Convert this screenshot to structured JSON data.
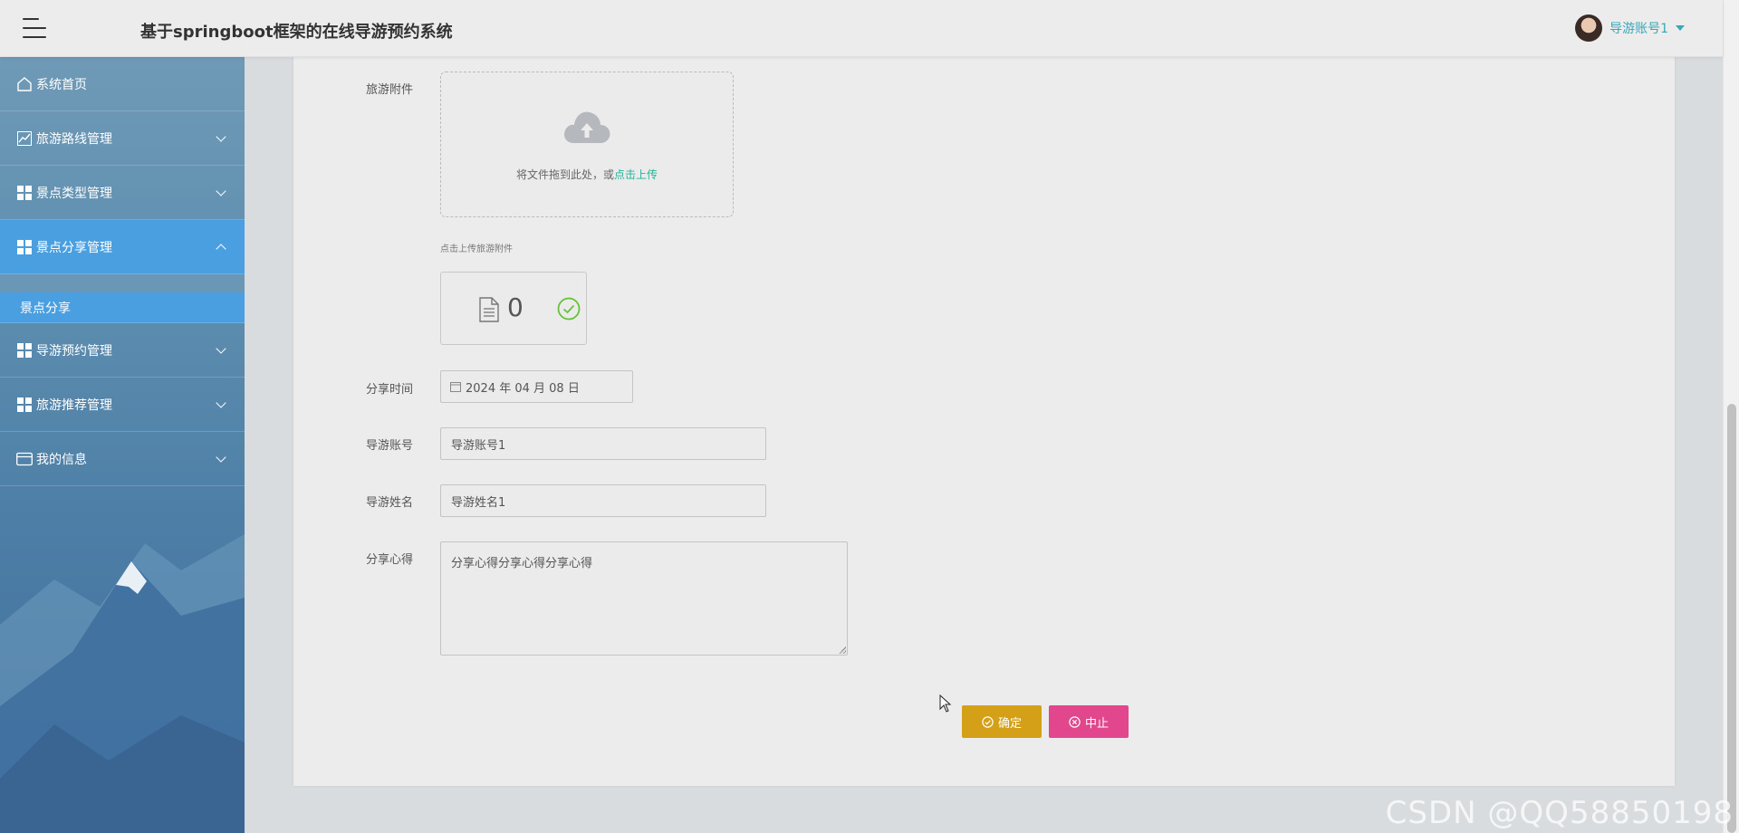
{
  "header": {
    "title": "基于springboot框架的在线导游预约系统",
    "user_name": "导游账号1"
  },
  "sidebar": {
    "items": [
      {
        "label": "系统首页",
        "icon": "home-icon"
      },
      {
        "label": "旅游路线管理",
        "icon": "chart-line-icon"
      },
      {
        "label": "景点类型管理",
        "icon": "grid-icon"
      },
      {
        "label": "景点分享管理",
        "icon": "grid-icon"
      },
      {
        "label": "导游预约管理",
        "icon": "grid-icon"
      },
      {
        "label": "旅游推荐管理",
        "icon": "grid-icon"
      },
      {
        "label": "我的信息",
        "icon": "card-icon"
      }
    ],
    "active_sub_item": "景点分享"
  },
  "form": {
    "attachment_label": "旅游附件",
    "upload_text": "将文件拖到此处，或",
    "upload_link": "点击上传",
    "upload_hint": "点击上传旅游附件",
    "file_count": "0",
    "share_time_label": "分享时间",
    "share_time_value": "2024 年 04 月 08 日",
    "guide_account_label": "导游账号",
    "guide_account_value": "导游账号1",
    "guide_name_label": "导游姓名",
    "guide_name_value": "导游姓名1",
    "experience_label": "分享心得",
    "experience_value": "分享心得分享心得分享心得",
    "confirm_label": "确定",
    "stop_label": "中止"
  },
  "colors": {
    "sidebar_active": "#4a9fe0",
    "confirm_button": "#d4a017",
    "stop_button": "#e2468c",
    "link": "#22b59a",
    "user_name": "#3aa7b6"
  },
  "watermark": "CSDN @QQ58850198"
}
